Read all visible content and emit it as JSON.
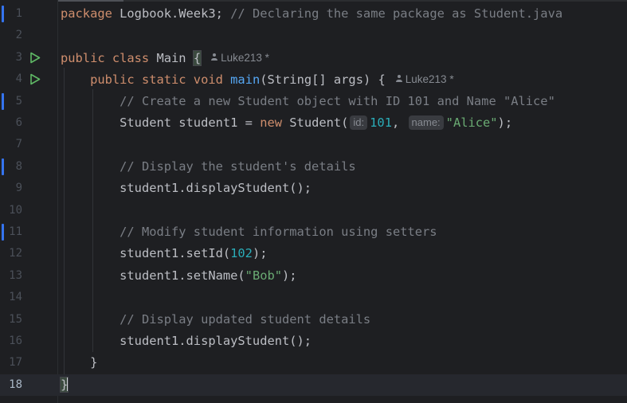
{
  "editor": {
    "lines": [
      {
        "n": "1"
      },
      {
        "n": "2"
      },
      {
        "n": "3"
      },
      {
        "n": "4"
      },
      {
        "n": "5"
      },
      {
        "n": "6"
      },
      {
        "n": "7"
      },
      {
        "n": "8"
      },
      {
        "n": "9"
      },
      {
        "n": "10"
      },
      {
        "n": "11"
      },
      {
        "n": "12"
      },
      {
        "n": "13"
      },
      {
        "n": "14"
      },
      {
        "n": "15"
      },
      {
        "n": "16"
      },
      {
        "n": "17"
      },
      {
        "n": "18"
      }
    ],
    "current_line": "18",
    "tokens": {
      "l1_kw": "package",
      "l1_txt": " Logbook.Week3; ",
      "l1_cm": "// Declaring the same package as Student.java",
      "l3_kw": "public class",
      "l3_txt": " Main ",
      "l3_brace": "{",
      "l3_author": "Luke213 *",
      "l4_indent": "    ",
      "l4_kw": "public static void",
      "l4_sp": " ",
      "l4_fn": "main",
      "l4_txt": "(String[] args) {",
      "l4_author": "Luke213 *",
      "l5_indent": "        ",
      "l5_cm": "// Create a new Student object with ID 101 and Name \"Alice\"",
      "l6_indent": "        ",
      "l6_txt1": "Student student1 = ",
      "l6_kw": "new",
      "l6_txt2": " Student(",
      "l6_hint_id": "id:",
      "l6_num": "101",
      "l6_comma": ",",
      "l6_hint_name": "name:",
      "l6_str": "\"Alice\"",
      "l6_end": ");",
      "l8_indent": "        ",
      "l8_cm": "// Display the student's details",
      "l9_indent": "        ",
      "l9_txt": "student1.displayStudent();",
      "l11_indent": "        ",
      "l11_cm": "// Modify student information using setters",
      "l12_indent": "        ",
      "l12_txt1": "student1.setId(",
      "l12_num": "102",
      "l12_txt2": ");",
      "l13_indent": "        ",
      "l13_txt1": "student1.setName(",
      "l13_str": "\"Bob\"",
      "l13_txt2": ");",
      "l15_indent": "        ",
      "l15_cm": "// Display updated student details",
      "l16_indent": "        ",
      "l16_txt": "student1.displayStudent();",
      "l17_indent": "    ",
      "l17_txt": "}",
      "l18_brace": "}"
    }
  },
  "colors": {
    "background": "#1e1f22",
    "keyword": "#cf8e6d",
    "comment": "#7a7e85",
    "function": "#56a8f5",
    "number": "#2aacb8",
    "string": "#6aab73",
    "change_marker": "#3574f0",
    "run_icon": "#5fb865"
  },
  "icons": {
    "run_gutter": "run-triangle-icon",
    "author": "person-icon"
  }
}
